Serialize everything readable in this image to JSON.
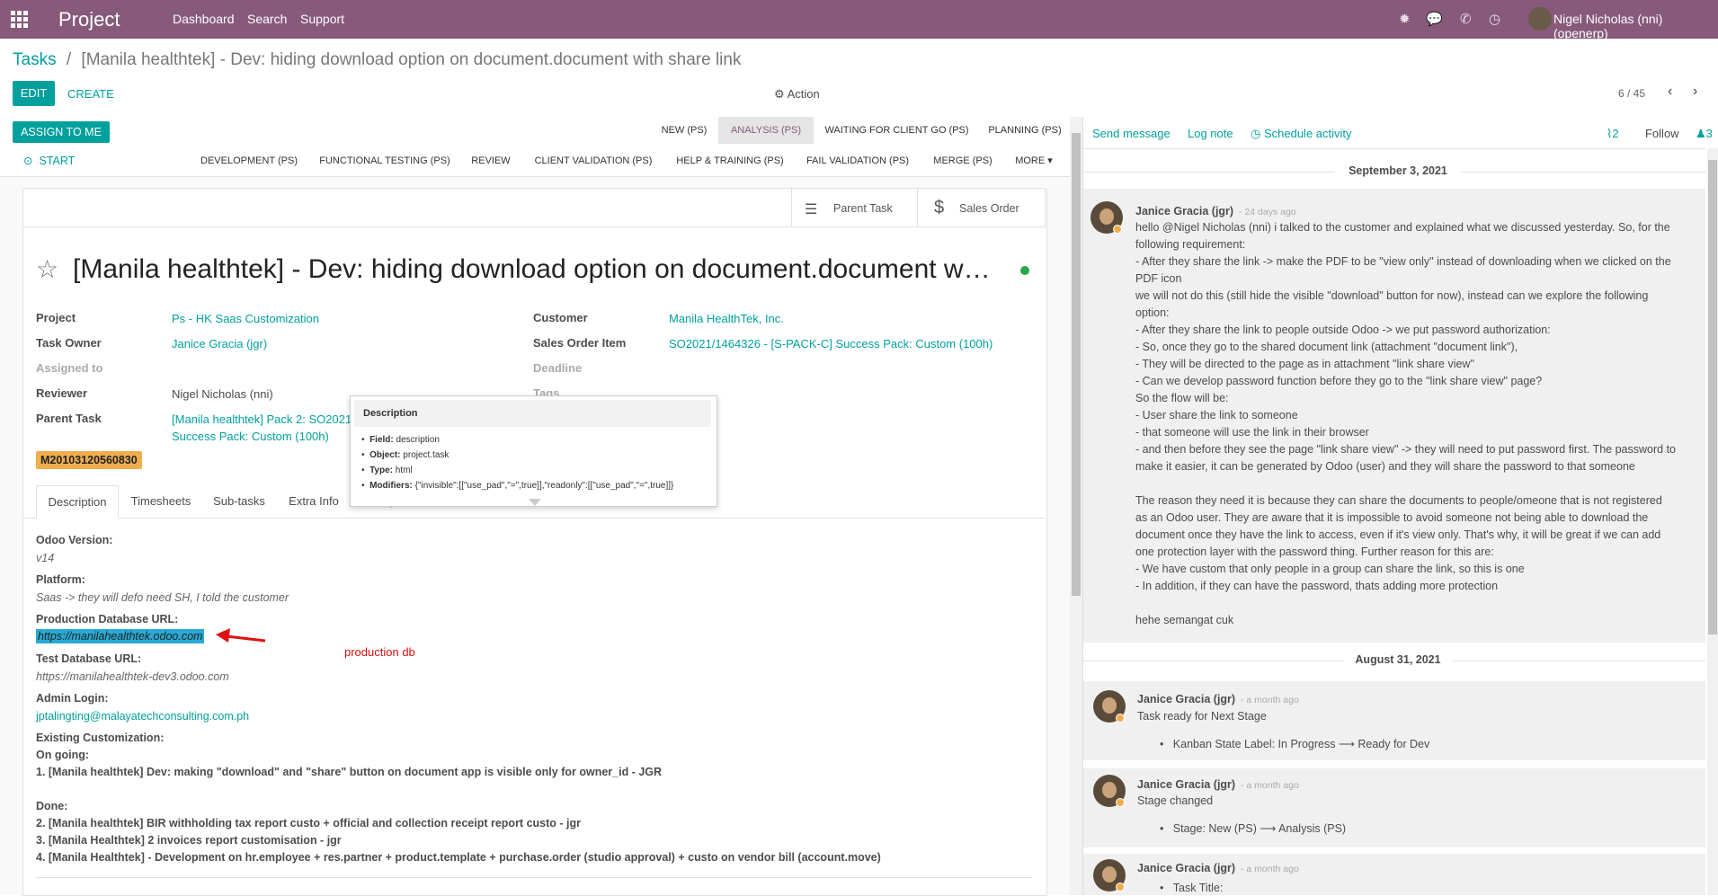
{
  "topbar": {
    "brand": "Project",
    "menu": [
      "Dashboard",
      "Search",
      "Support"
    ],
    "user": "Nigel Nicholas (nni) (openerp)"
  },
  "breadcrumb": {
    "root": "Tasks",
    "sep": "/",
    "current": "[Manila healthtek] - Dev: hiding download option on document.document with share link"
  },
  "control": {
    "edit": "EDIT",
    "create": "CREATE",
    "action": "Action",
    "pager": "6 / 45"
  },
  "header": {
    "assign_to_me": "ASSIGN TO ME",
    "start": "START",
    "stages_row1": [
      "NEW (PS)",
      "ANALYSIS (PS)",
      "WAITING FOR CLIENT GO (PS)",
      "PLANNING (PS)"
    ],
    "stages_row2": [
      "DEVELOPMENT (PS)",
      "FUNCTIONAL TESTING (PS)",
      "REVIEW",
      "CLIENT VALIDATION (PS)",
      "HELP & TRAINING (PS)",
      "FAIL VALIDATION (PS)",
      "MERGE (PS)",
      "MORE"
    ]
  },
  "buttonbox": {
    "parent_task": "Parent Task",
    "sales_order": "Sales Order"
  },
  "task": {
    "title": "[Manila healthtek] - Dev: hiding download option on document.document w…",
    "fields_left": {
      "project_label": "Project",
      "project": "Ps - HK Saas Customization",
      "owner_label": "Task Owner",
      "owner": "Janice Gracia (jgr)",
      "assigned_label": "Assigned to",
      "reviewer_label": "Reviewer",
      "reviewer": "Nigel Nicholas (nni)",
      "parent_label": "Parent Task",
      "parent_1": "[Manila healthtek] Pack 2: SO2021,",
      "parent_2": "Success Pack: Custom (100h)"
    },
    "fields_right": {
      "customer_label": "Customer",
      "customer": "Manila HealthTek, Inc.",
      "soi_label": "Sales Order Item",
      "soi": "SO2021/1464326 - [S-PACK-C] Success Pack: Custom (100h)",
      "deadline_label": "Deadline",
      "tags_label": "Tags"
    },
    "tag": "M20103120560830"
  },
  "tabs": [
    "Description",
    "Timesheets",
    "Sub-tasks",
    "Extra Info",
    "Enterprise",
    "Databases"
  ],
  "tooltip": {
    "title": "Description",
    "field_label": "Field:",
    "field": "description",
    "object_label": "Object:",
    "object": "project.task",
    "type_label": "Type:",
    "type": "html",
    "modifiers_label": "Modifiers:",
    "modifiers": "{\"invisible\":[[\"use_pad\",\"=\",true]],\"readonly\":[[\"use_pad\",\"=\",true]]}"
  },
  "description": {
    "odoo_version_label": "Odoo Version:",
    "odoo_version": "v14",
    "platform_label": "Platform:",
    "platform": "Saas -> they will defo need SH, I told the customer",
    "prod_label": "Production Database URL:",
    "prod_url": "https://manilahealthtek.odoo.com",
    "annotation": "production db",
    "test_label": "Test Database URL:",
    "test_url": "https://manilahealthtek-dev3.odoo.com",
    "admin_label": "Admin Login:",
    "admin": "jptalingting@malayatechconsulting.com.ph",
    "existing_label": "Existing Customization:",
    "ongoing_label": "On going:",
    "ongoing_1": "1. [Manila healthtek] Dev: making \"download\" and \"share\" button on document app is visible only for owner_id - JGR",
    "done_label": "Done:",
    "done_2": "2. [Manila healthtek] BIR withholding tax report custo + official and collection receipt report custo - jgr",
    "done_3": "3. [Manila Healthtek] 2 invoices report customisation - jgr",
    "done_4": "4. [Manila Healthtek] - Development on hr.employee + res.partner + product.template + purchase.order (studio approval) + custo on vendor bill (account.move)"
  },
  "chatter": {
    "send_message": "Send message",
    "log_note": "Log note",
    "schedule": "Schedule activity",
    "attachments": "2",
    "follow": "Follow",
    "followers": "3",
    "date1": "September 3, 2021",
    "msg1": {
      "author": "Janice Gracia (jgr)",
      "time": "- 24 days ago",
      "lines": [
        "hello @Nigel Nicholas (nni) i talked to the customer and explained what we discussed yesterday. So, for the",
        "following requirement:",
        "- After they share the link -> make the PDF to be \"view only\" instead of downloading when we clicked on the",
        "PDF icon",
        "we will not do this (still hide the visible \"download\" button for now), instead can we explore the following",
        "option:",
        "- After they share the link to people outside Odoo -> we put password authorization:",
        "- So, once they go to the shared document link (attachment \"document link\"),",
        "- They will be directed to the page as in attachment \"link share view\"",
        "- Can we develop password function before they go to the \"link share view\" page?",
        "So the flow will be:",
        "- User share the link to someone",
        "- that someone will use the link in their browser",
        "- and then before they see the page \"link share view\" -> they will need to put password first. The password to",
        "make it easier, it can be generated by Odoo (user) and they will share the password to that someone",
        "",
        "The reason they need it is because they can share the documents to people/omeone that is not registered",
        "as an Odoo user. They are aware that it is impossible to avoid someone not being able to download the",
        "document once they have the link to access, even if it's view only. That's why, it will be great if we can add",
        "one protection layer with the password thing. Further reason for this are:",
        "- We have custom that only people in a group can share the link, so this is one",
        "- In addition, if they can have the password, thats adding more protection",
        "",
        "hehe semangat cuk"
      ]
    },
    "date2": "August 31, 2021",
    "msg2": {
      "author": "Janice Gracia (jgr)",
      "time": "- a month ago",
      "body": "Task ready for Next Stage",
      "bullet": "Kanban State Label: In Progress ⟶ Ready for Dev"
    },
    "msg3": {
      "author": "Janice Gracia (jgr)",
      "time": "- a month ago",
      "body": "Stage changed",
      "bullet": "Stage: New (PS) ⟶ Analysis (PS)"
    },
    "msg4": {
      "author": "Janice Gracia (jgr)",
      "time": "- a month ago",
      "bullet": "Task Title:"
    }
  }
}
